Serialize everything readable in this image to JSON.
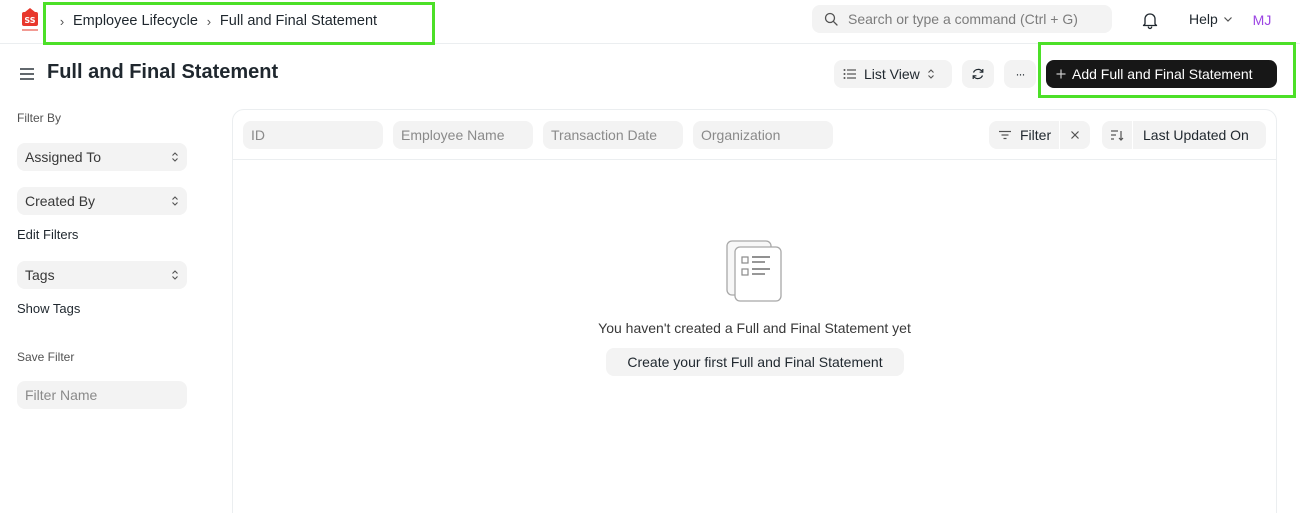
{
  "navbar": {
    "breadcrumbs": [
      {
        "label": "Employee Lifecycle"
      },
      {
        "label": "Full and Final Statement"
      }
    ],
    "search_placeholder": "Search or type a command (Ctrl + G)",
    "help_label": "Help",
    "avatar_initials": "MJ"
  },
  "page": {
    "title": "Full and Final Statement",
    "list_view_label": "List View",
    "refresh_icon": "refresh-icon",
    "more_label": "···",
    "add_button_label": "Add Full and Final Statement"
  },
  "sidebar": {
    "filter_by_label": "Filter By",
    "selects": [
      "Assigned To",
      "Created By"
    ],
    "edit_filters_label": "Edit Filters",
    "tags_select": "Tags",
    "show_tags_label": "Show Tags",
    "save_filter_label": "Save Filter",
    "filter_name_placeholder": "Filter Name"
  },
  "list": {
    "filter_fields": [
      {
        "placeholder": "ID"
      },
      {
        "placeholder": "Employee Name"
      },
      {
        "placeholder": "Transaction Date"
      },
      {
        "placeholder": "Organization"
      }
    ],
    "filter_label": "Filter",
    "sort_label": "Last Updated On",
    "empty_message": "You haven't created a Full and Final Statement yet",
    "empty_button_label": "Create your first Full and Final Statement"
  },
  "colors": {
    "primary_button": "#171717",
    "highlight_box": "#4ce028",
    "avatar_text": "#9c45e3",
    "logo_red": "#e8372c"
  }
}
